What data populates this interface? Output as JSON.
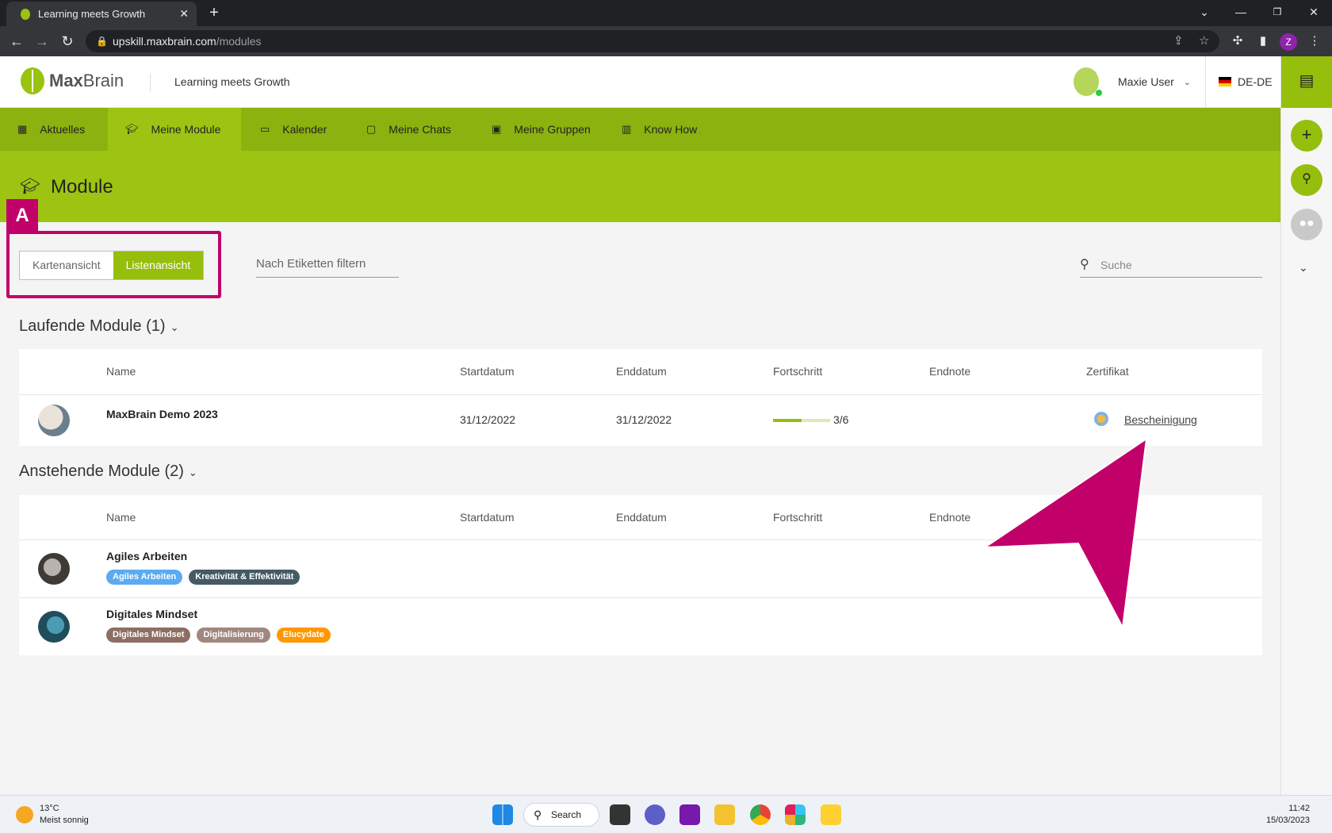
{
  "browser": {
    "tab_title": "Learning meets Growth",
    "url_domain": "upskill.maxbrain.com",
    "url_path": "/modules",
    "profile_initial": "Z"
  },
  "header": {
    "brand_bold": "Max",
    "brand_rest": "Brain",
    "tagline": "Learning meets Growth",
    "user_name": "Maxie User",
    "language": "DE-DE"
  },
  "nav": {
    "items": [
      {
        "label": "Aktuelles",
        "icon": "grid-icon"
      },
      {
        "label": "Meine Module",
        "icon": "graduation-cap-icon"
      },
      {
        "label": "Kalender",
        "icon": "calendar-icon"
      },
      {
        "label": "Meine Chats",
        "icon": "chat-box-icon"
      },
      {
        "label": "Meine Gruppen",
        "icon": "group-icon"
      },
      {
        "label": "Know How",
        "icon": "book-icon"
      }
    ],
    "active": "Meine Module"
  },
  "page": {
    "title": "Module",
    "annotation_label": "A",
    "view_card": "Kartenansicht",
    "view_list": "Listenansicht",
    "filter_placeholder": "Nach Etiketten filtern",
    "search_placeholder": "Suche"
  },
  "columns": {
    "name": "Name",
    "start": "Startdatum",
    "end": "Enddatum",
    "progress": "Fortschritt",
    "grade": "Endnote",
    "certificate": "Zertifikat"
  },
  "running": {
    "title": "Laufende Module (1)",
    "modules": [
      {
        "name": "MaxBrain Demo 2023",
        "start": "31/12/2022",
        "end": "31/12/2022",
        "progress_text": "3/6",
        "progress_fraction": 0.5,
        "certificate": "Bescheinigung"
      }
    ]
  },
  "upcoming": {
    "title": "Anstehende Module (2)",
    "modules": [
      {
        "name": "Agiles Arbeiten",
        "tags": [
          {
            "label": "Agiles Arbeiten",
            "color": "#5aabf0"
          },
          {
            "label": "Kreativität & Effektivität",
            "color": "#455a64"
          }
        ]
      },
      {
        "name": "Digitales Mindset",
        "tags": [
          {
            "label": "Digitales Mindset",
            "color": "#8d6e63"
          },
          {
            "label": "Digitalisierung",
            "color": "#a1887f"
          },
          {
            "label": "Elucydate",
            "color": "#ff9800"
          }
        ]
      }
    ]
  },
  "colors": {
    "brand_green": "#96be0d",
    "nav_green": "#8bb20e",
    "annotation": "#c2006a"
  },
  "taskbar": {
    "temperature": "13°C",
    "weather": "Meist sonnig",
    "search": "Search",
    "time": "11:42",
    "date": "15/03/2023"
  }
}
